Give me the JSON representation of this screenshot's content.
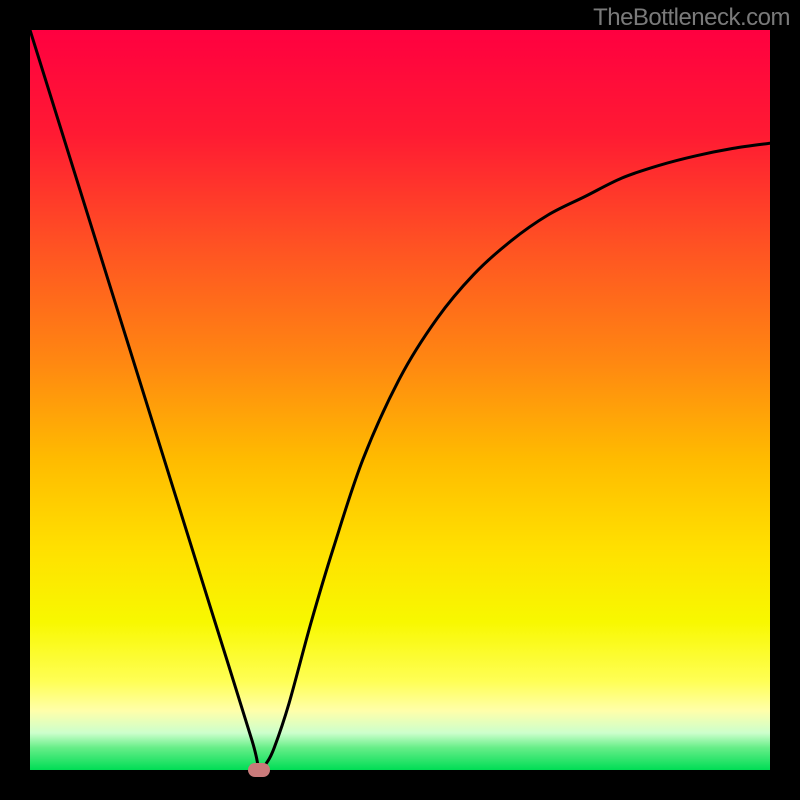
{
  "watermark": "TheBottleneck.com",
  "chart_data": {
    "type": "line",
    "title": "",
    "xlabel": "",
    "ylabel": "",
    "xlim": [
      0,
      100
    ],
    "ylim": [
      0,
      100
    ],
    "series": [
      {
        "name": "bottleneck-curve",
        "x": [
          0,
          5,
          10,
          15,
          20,
          25,
          30,
          31,
          32,
          33,
          35,
          38,
          41,
          45,
          50,
          55,
          60,
          65,
          70,
          75,
          80,
          85,
          90,
          95,
          100
        ],
        "values": [
          100,
          84,
          68,
          52,
          36,
          20,
          4,
          0,
          1,
          3,
          9,
          20,
          30,
          42,
          53,
          61,
          67,
          71.5,
          75,
          77.5,
          80,
          81.7,
          83,
          84,
          84.7
        ]
      }
    ],
    "optimal_point": {
      "x": 31,
      "y": 0
    },
    "gradient_stops": [
      {
        "offset": 0,
        "color": "#ff0040"
      },
      {
        "offset": 14,
        "color": "#ff1a33"
      },
      {
        "offset": 30,
        "color": "#ff5522"
      },
      {
        "offset": 45,
        "color": "#ff8811"
      },
      {
        "offset": 58,
        "color": "#ffbb00"
      },
      {
        "offset": 70,
        "color": "#ffe000"
      },
      {
        "offset": 80,
        "color": "#f8f800"
      },
      {
        "offset": 88,
        "color": "#ffff55"
      },
      {
        "offset": 92,
        "color": "#ffffaa"
      },
      {
        "offset": 95,
        "color": "#ccffcc"
      },
      {
        "offset": 97,
        "color": "#66ee88"
      },
      {
        "offset": 100,
        "color": "#00dd55"
      }
    ]
  }
}
